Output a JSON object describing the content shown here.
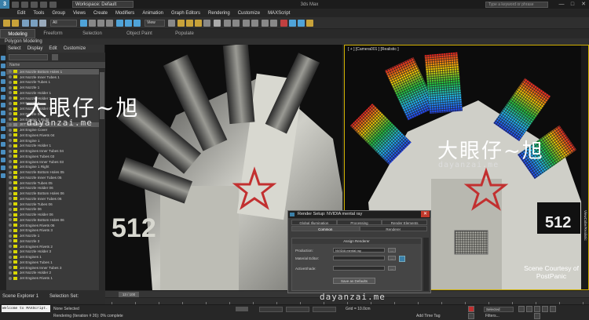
{
  "window": {
    "workspace": "Workspace: Default",
    "title": "3ds Max",
    "search_placeholder": "Type a keyword or phrase",
    "min": "—",
    "max": "□",
    "close": "✕"
  },
  "menu": [
    "Edit",
    "Tools",
    "Group",
    "Views",
    "Create",
    "Modifiers",
    "Animation",
    "Graph Editors",
    "Rendering",
    "Customize",
    "MAXScript"
  ],
  "toolbar": {
    "selection_filter": "All",
    "view": "View",
    "accent": "#4fa3d8"
  },
  "ribbon": {
    "tabs": [
      "Modeling",
      "Freeform",
      "Selection",
      "Object Paint",
      "Populate"
    ],
    "active": "Modeling",
    "sub": "Polygon Modeling"
  },
  "scene_explorer": {
    "menu": [
      "Select",
      "Display",
      "Edit",
      "Customize"
    ],
    "column_header": "Name",
    "items": [
      {
        "name": "Jet Nozzle Bottom Holes 1",
        "selected": true
      },
      {
        "name": "Jet Nozzle Inner Tubes 1"
      },
      {
        "name": "Jet Nozzle Tubes 1"
      },
      {
        "name": "Jet Nozzle 1"
      },
      {
        "name": "Jet Nozzle Holder 1"
      },
      {
        "name": "Jet Nozzle Holder 2"
      },
      {
        "name": "Jet Nozzle 2"
      },
      {
        "name": "Jet Nozzle Holder 04"
      },
      {
        "name": "Jet Nozzle 04"
      },
      {
        "name": "Jet Engine 1 Right"
      },
      {
        "name": "JET ENGINES",
        "group": true,
        "selected": true
      },
      {
        "name": "Jet Engine Cover"
      },
      {
        "name": "Jet Engines Rivets 04"
      },
      {
        "name": "Jet Engine 1"
      },
      {
        "name": "Jet Nozzle Holder 1"
      },
      {
        "name": "Jet Engines Inner Tubes 04"
      },
      {
        "name": "Jet Engines Tubes 03"
      },
      {
        "name": "Jet Engines Inner Tubes 03"
      },
      {
        "name": "Jet Engine 1 Right"
      },
      {
        "name": "Jet Nozzle Bottom Holes 05"
      },
      {
        "name": "Jet Nozzle Inner Tubes 05"
      },
      {
        "name": "Jet Nozzle Tubes 05"
      },
      {
        "name": "Jet Nozzle Holder 06"
      },
      {
        "name": "Jet Nozzle Bottom Holes 06"
      },
      {
        "name": "Jet Nozzle Inner Tubes 06"
      },
      {
        "name": "Jet Nozzle Tubes 06"
      },
      {
        "name": "Jet Nozzle 06"
      },
      {
        "name": "Jet Nozzle Holder 06"
      },
      {
        "name": "Jet Nozzle Bottom Holes 06"
      },
      {
        "name": "Jet Engines Rivets 06"
      },
      {
        "name": "Jet Engines Rivets 3"
      },
      {
        "name": "Jet Nozzle 1"
      },
      {
        "name": "Jet Nozzle 3"
      },
      {
        "name": "Jet Engines Rivets 2"
      },
      {
        "name": "Jet Nozzle Holder 3"
      },
      {
        "name": "Jet Engines 1"
      },
      {
        "name": "Jet Engines Tubes 1"
      },
      {
        "name": "Jet Engines Inner Tubes 3"
      },
      {
        "name": "Jet Nozzle Holder 2"
      },
      {
        "name": "Jet Engines Rivets 1"
      }
    ]
  },
  "viewport_right": {
    "label": "[ + ] [Camera001 ] [Realistic ]",
    "credit_line1": "Scene Courtesy of",
    "credit_line2": "PostPanic",
    "side_label": "ViewCube/Realistic"
  },
  "watermark": {
    "cn": "大眼仔~旭",
    "en": "dayanzai.me"
  },
  "render_setup": {
    "title": "Render Setup: NVIDIA mental ray",
    "tabs_row1": [
      "Global Illumination",
      "Processing",
      "Render Elements"
    ],
    "tabs_row2": [
      "Common",
      "Renderer"
    ],
    "section": "Assign Renderer",
    "production_label": "Production:",
    "production_value": "NVIDIA mental ray",
    "material_label": "Material Editor:",
    "activeshade_label": "ActiveShade:",
    "save_defaults": "Save as Defaults",
    "browse": "...",
    "lock": "🔒"
  },
  "timeline": {
    "frame": "13 / 100"
  },
  "bottom": {
    "scene_explorer_name": "Scene Explorer 1",
    "selection_set_label": "Selection Set:",
    "maxscript": "Welcome to MAXScript.",
    "selected": "None Selected",
    "rendering": "Rendering (Iteration # 26): 0% complete",
    "grid": "Grid = 10.0cm",
    "selected_dropdown": "Selected",
    "add_time_tag": "Add Time Tag",
    "filters": "Filters..."
  }
}
